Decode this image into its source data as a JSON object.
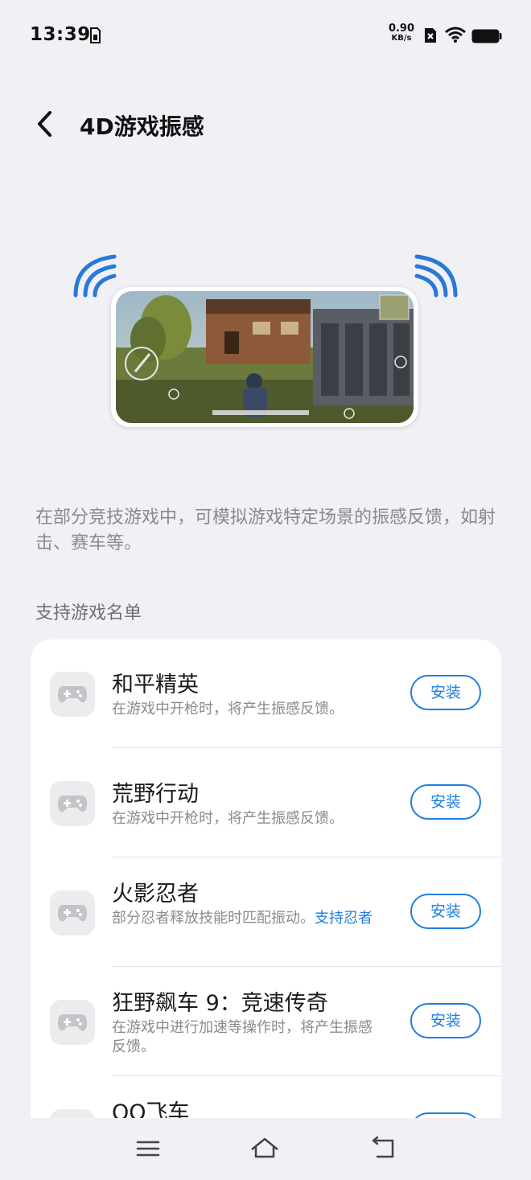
{
  "status_bar": {
    "time": "13:39",
    "net_speed_value": "0.90",
    "net_speed_unit": "KB/s",
    "icons": [
      "sim-card-icon",
      "no-sim-icon",
      "wifi-icon",
      "battery-icon"
    ]
  },
  "header": {
    "back_icon": "chevron-left-icon",
    "title": "4D游戏振感"
  },
  "description": "在部分竞技游戏中，可模拟游戏特定场景的振感反馈，如射击、赛车等。",
  "section_title": "支持游戏名单",
  "games": [
    {
      "name": "和平精英",
      "desc": "在游戏中开枪时，将产生振感反馈。",
      "desc_link": "",
      "button": "安装",
      "icon": "gamepad-icon"
    },
    {
      "name": "荒野行动",
      "desc": "在游戏中开枪时，将产生振感反馈。",
      "desc_link": "",
      "button": "安装",
      "icon": "gamepad-icon"
    },
    {
      "name": "火影忍者",
      "desc": "部分忍者释放技能时匹配振动。",
      "desc_link": "支持忍者",
      "button": "安装",
      "icon": "gamepad-icon"
    },
    {
      "name": "狂野飙车 9：竞速传奇",
      "desc": "在游戏中进行加速等操作时，将产生振感反馈。",
      "desc_link": "",
      "button": "安装",
      "icon": "gamepad-icon"
    },
    {
      "name": "QQ飞车",
      "desc": "",
      "desc_link": "",
      "button": "安装",
      "icon": "gamepad-icon"
    }
  ],
  "nav_bar": {
    "menu_icon": "menu-icon",
    "home_icon": "home-icon",
    "back_icon": "back-arrow-icon"
  },
  "colors": {
    "accent": "#1f7fe0",
    "background": "#f0f0f5",
    "card": "#ffffff",
    "secondary_text": "#8a8a8e"
  }
}
